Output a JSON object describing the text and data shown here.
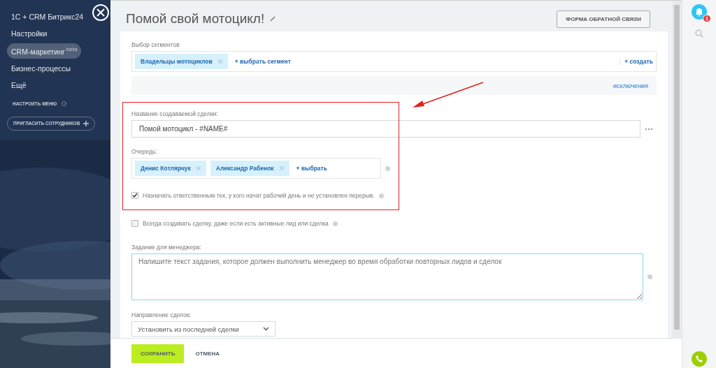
{
  "sidebar": {
    "items": [
      {
        "label": "1С + CRM Битрикс24",
        "selected": false
      },
      {
        "label": "Настройки",
        "selected": false
      },
      {
        "label": "CRM-маркетинг",
        "badge": "beta",
        "selected": true
      },
      {
        "label": "Бизнес-процессы",
        "selected": false
      },
      {
        "label": "Ещё",
        "selected": false
      }
    ],
    "configure_menu": "НАСТРОИТЬ МЕНЮ",
    "invite": "ПРИГЛАСИТЬ СОТРУДНИКОВ"
  },
  "header": {
    "title": "Помой свой мотоцикл!",
    "feedback_button": "ФОРМА ОБРАТНОЙ СВЯЗИ"
  },
  "segments": {
    "label": "Выбор сегментов",
    "tags": [
      "Владельцы мотоциклов"
    ],
    "select_link": "+ выбрать сегмент",
    "create_link": "+ создать",
    "exclusions_link": "исключения"
  },
  "deal_name": {
    "label": "Название создаваемой сделки:",
    "value": "Помой мотоцикл - #NAME#"
  },
  "queue": {
    "label": "Очередь:",
    "tags": [
      "Денис Котлярчук",
      "Александр Рабенок"
    ],
    "select_link": "+ выбрать"
  },
  "options": [
    {
      "label": "Назначать ответственным тех, у кого начат рабочий день и не установлен перерыв.",
      "checked": true
    },
    {
      "label": "Всегда создавать сделку, даже если есть активные лид или сделка",
      "checked": false
    }
  ],
  "task": {
    "label": "Задание для менеджера:",
    "placeholder": "Напишите текст задания, которое должен выполнить менеджер во время обработки повторных лидов и сделок"
  },
  "direction": {
    "label": "Направление сделок:",
    "value": "Установить из последней сделки"
  },
  "footer": {
    "save": "СОХРАНИТЬ",
    "cancel": "ОТМЕНА"
  },
  "notifications": {
    "count": "1"
  }
}
